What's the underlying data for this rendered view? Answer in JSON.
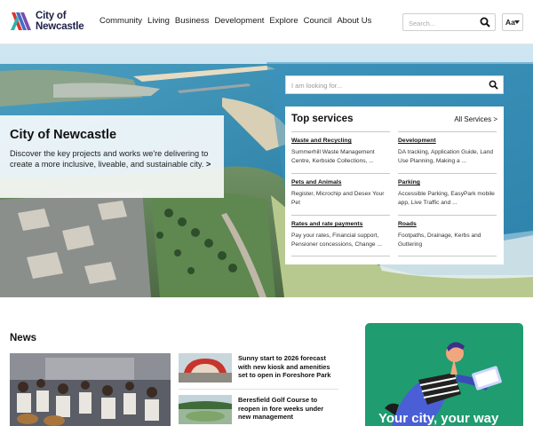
{
  "brand": {
    "name_line1": "City of",
    "name_line2": "Newcastle"
  },
  "nav": {
    "items": [
      "Community",
      "Living",
      "Business",
      "Development",
      "Explore",
      "Council",
      "About Us"
    ]
  },
  "header_search": {
    "placeholder": "Search..."
  },
  "text_size_button": {
    "label": "Aa"
  },
  "hero": {
    "search_placeholder": "I am looking for...",
    "intro_title": "City of Newcastle",
    "intro_text": "Discover the key projects and works we're delivering to create a more inclusive, liveable, and sustainable city.",
    "intro_chevron": ">"
  },
  "services": {
    "title": "Top services",
    "all_label": "All Services >",
    "items": [
      {
        "title": "Waste and Recycling",
        "desc": "Summerhill Waste Management Centre, Kerbside Collections, ..."
      },
      {
        "title": "Development",
        "desc": "DA tracking, Application Guide, Land Use Planning, Making a ..."
      },
      {
        "title": "Pets and Animals",
        "desc": "Register, Microchip and Desex Your Pet"
      },
      {
        "title": "Parking",
        "desc": "Accessible Parking, EasyPark mobile app, Live Traffic and ..."
      },
      {
        "title": "Rates and rate payments",
        "desc": "Pay your rates, Financial support, Pensioner concessions, Change ..."
      },
      {
        "title": "Roads",
        "desc": "Footpaths, Drainage, Kerbs and Guttering"
      }
    ]
  },
  "news": {
    "heading": "News",
    "items": [
      {
        "title": "Sunny start to 2026 forecast with new kiosk and amenities set to open in Foreshore Park"
      },
      {
        "title": "Beresfield Golf Course to reopen in fore weeks under new management"
      }
    ]
  },
  "promo": {
    "text": "Your city, your way"
  },
  "colors": {
    "brand_navy": "#1d2046",
    "promo_green": "#1f9c70",
    "logo_red": "#e2322d",
    "logo_blue": "#3f6fc6",
    "logo_purple": "#6b3aa3",
    "logo_teal": "#2ab4b0"
  },
  "icons": {
    "search": "search-icon",
    "caret": "chevron-down-icon"
  }
}
